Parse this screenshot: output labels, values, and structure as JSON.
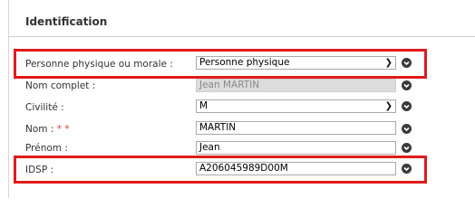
{
  "section": {
    "title": "Identification"
  },
  "rows": {
    "personne": {
      "label": "Personne physique ou morale :",
      "value": "Personne physique"
    },
    "nom_complet": {
      "label": "Nom complet :",
      "value": "Jean MARTIN"
    },
    "civilite": {
      "label": "Civilité :",
      "value": "M"
    },
    "nom": {
      "label": "Nom :",
      "required_mark": "* *",
      "value": "MARTIN"
    },
    "prenom": {
      "label": "Prénom :",
      "value": "Jean"
    },
    "idsp": {
      "label": "IDSP :",
      "value": "A206045989D00M"
    }
  },
  "colors": {
    "highlight": "#e01b1b",
    "required": "#e03b3b",
    "disabled_bg": "#dcdcdc"
  },
  "icons": {
    "info": "chevron-down-circle-icon",
    "dropdown": "chevron-down-icon"
  }
}
